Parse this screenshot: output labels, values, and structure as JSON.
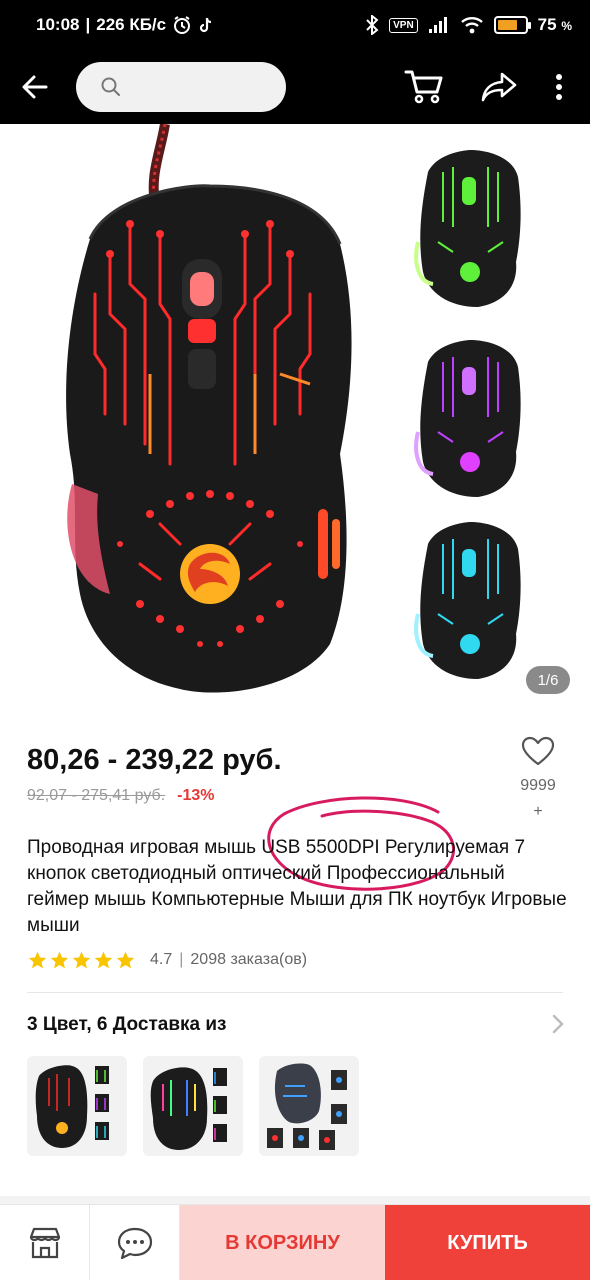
{
  "status_bar": {
    "time": "10:08",
    "speed": "226 КБ/с",
    "vpn": "VPN",
    "battery_percent": "75",
    "battery_suffix": "%",
    "battery_level": 0.75
  },
  "toolbar": {
    "search_placeholder": "",
    "icons": [
      "back-arrow-icon",
      "search-icon",
      "cart-icon",
      "share-icon",
      "more-vertical-icon"
    ]
  },
  "gallery": {
    "page_indicator": "1/6",
    "variant_colors": [
      "#ff2a2a",
      "#5ef03a",
      "#c040ff",
      "#30d8f0"
    ]
  },
  "product": {
    "price": "80,26 - 239,22 руб.",
    "old_price": "92,07 - 275,41 руб.",
    "discount": "-13%",
    "wishlist_count": "9999",
    "wishlist_plus": "+",
    "title": "Проводная игровая мышь USB 5500DPI Регулируемая 7 кнопок светодиодный оптический Профессиональный геймер мышь Компьютерные Мыши для ПК ноутбук Игровые мыши",
    "rating": "4.7",
    "rating_sep": "|",
    "orders": "2098 заказа(ов)",
    "stars": 5
  },
  "variants": {
    "label": "3 Цвет, 6 Доставка из",
    "count": 3
  },
  "bottom_bar": {
    "cart_label": "В КОРЗИНУ",
    "buy_label": "КУПИТЬ"
  },
  "colors": {
    "accent": "#f0403a",
    "accent_light": "#fbd4d2",
    "star": "#f9c400",
    "annotation": "#d81b60"
  }
}
